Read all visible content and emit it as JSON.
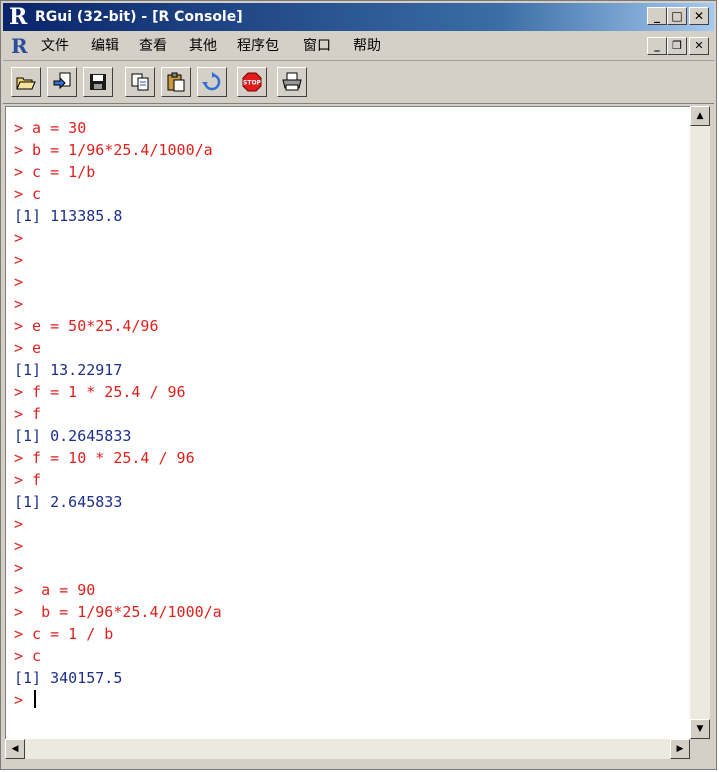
{
  "window": {
    "app_icon": "R",
    "title": "RGui (32-bit) - [R Console]"
  },
  "menubar": {
    "items": [
      "文件",
      "编辑",
      "查看",
      "其他",
      "程序包",
      "窗口",
      "帮助"
    ]
  },
  "toolbar": {
    "buttons": [
      "open-script-icon",
      "load-workspace-icon",
      "save-workspace-icon",
      "copy-icon",
      "paste-icon",
      "copy-paste-icon",
      "stop-icon",
      "print-icon"
    ],
    "stop_label": "STOP"
  },
  "console": {
    "lines": [
      {
        "type": "in",
        "text": "> a = 30"
      },
      {
        "type": "in",
        "text": "> b = 1/96*25.4/1000/a"
      },
      {
        "type": "in",
        "text": "> c = 1/b"
      },
      {
        "type": "in",
        "text": "> c"
      },
      {
        "type": "out",
        "text": "[1] 113385.8"
      },
      {
        "type": "in",
        "text": ">"
      },
      {
        "type": "in",
        "text": ">"
      },
      {
        "type": "in",
        "text": ">"
      },
      {
        "type": "in",
        "text": ">"
      },
      {
        "type": "in",
        "text": "> e = 50*25.4/96"
      },
      {
        "type": "in",
        "text": "> e"
      },
      {
        "type": "out",
        "text": "[1] 13.22917"
      },
      {
        "type": "in",
        "text": "> f = 1 * 25.4 / 96"
      },
      {
        "type": "in",
        "text": "> f"
      },
      {
        "type": "out",
        "text": "[1] 0.2645833"
      },
      {
        "type": "in",
        "text": "> f = 10 * 25.4 / 96"
      },
      {
        "type": "in",
        "text": "> f"
      },
      {
        "type": "out",
        "text": "[1] 2.645833"
      },
      {
        "type": "in",
        "text": ">"
      },
      {
        "type": "in",
        "text": ">"
      },
      {
        "type": "in",
        "text": ">"
      },
      {
        "type": "in",
        "text": ">  a = 90"
      },
      {
        "type": "in",
        "text": ">  b = 1/96*25.4/1000/a"
      },
      {
        "type": "in",
        "text": "> c = 1 / b"
      },
      {
        "type": "in",
        "text": "> c"
      },
      {
        "type": "out",
        "text": "[1] 340157.5"
      }
    ],
    "prompt": "> "
  },
  "colors": {
    "input": "#e0201d",
    "output": "#1c2f8a",
    "title_bar": "#0a246a"
  }
}
